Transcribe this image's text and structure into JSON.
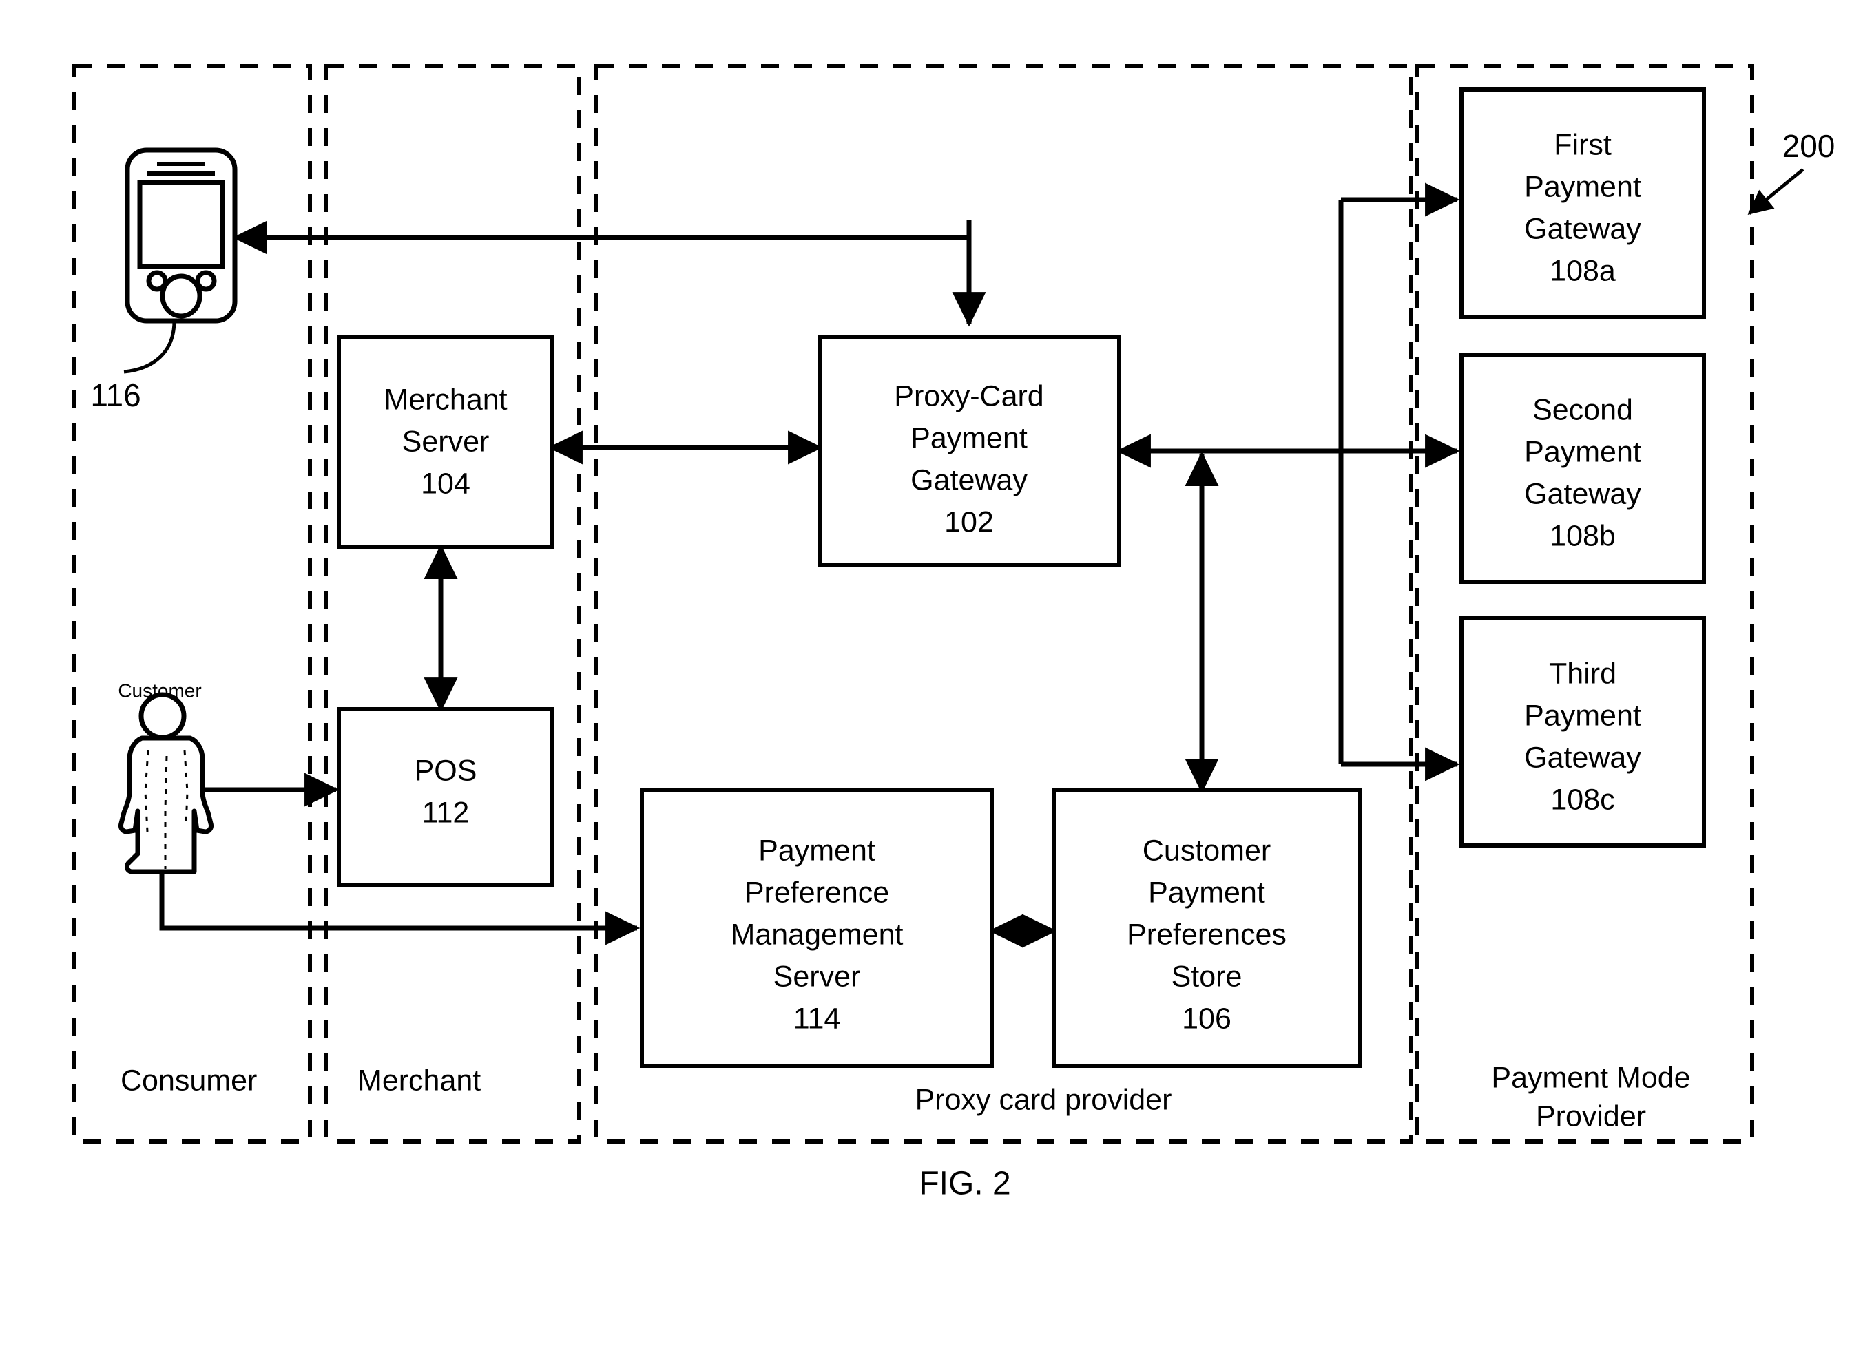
{
  "figure": {
    "caption": "FIG. 2",
    "system_reference": "200"
  },
  "zones": [
    {
      "id": "consumer",
      "label": "Consumer"
    },
    {
      "id": "merchant",
      "label": "Merchant"
    },
    {
      "id": "proxy_card_provider",
      "label": "Proxy card provider"
    },
    {
      "id": "payment_mode_provider",
      "label": "Payment Mode\nProvider",
      "label_line1": "Payment Mode",
      "label_line2": "Provider"
    }
  ],
  "nodes": {
    "mobile_device": {
      "reference": "116",
      "icon": "mobile-phone-icon"
    },
    "customer": {
      "label": "Customer",
      "icon": "person-icon"
    },
    "merchant_server": {
      "lines": [
        "Merchant",
        "Server",
        "104"
      ],
      "l1": "Merchant",
      "l2": "Server",
      "l3": "104"
    },
    "pos": {
      "lines": [
        "POS",
        "112"
      ],
      "l1": "POS",
      "l2": "112"
    },
    "proxy_card_payment_gateway": {
      "lines": [
        "Proxy-Card",
        "Payment",
        "Gateway",
        "102"
      ],
      "l1": "Proxy-Card",
      "l2": "Payment",
      "l3": "Gateway",
      "l4": "102"
    },
    "payment_preference_management_server": {
      "lines": [
        "Payment",
        "Preference",
        "Management",
        "Server",
        "114"
      ],
      "l1": "Payment",
      "l2": "Preference",
      "l3": "Management",
      "l4": "Server",
      "l5": "114"
    },
    "customer_payment_preferences_store": {
      "lines": [
        "Customer",
        "Payment",
        "Preferences",
        "Store",
        "106"
      ],
      "l1": "Customer",
      "l2": "Payment",
      "l3": "Preferences",
      "l4": "Store",
      "l5": "106"
    },
    "first_payment_gateway": {
      "lines": [
        "First",
        "Payment",
        "Gateway",
        "108a"
      ],
      "l1": "First",
      "l2": "Payment",
      "l3": "Gateway",
      "l4": "108a"
    },
    "second_payment_gateway": {
      "lines": [
        "Second",
        "Payment",
        "Gateway",
        "108b"
      ],
      "l1": "Second",
      "l2": "Payment",
      "l3": "Gateway",
      "l4": "108b"
    },
    "third_payment_gateway": {
      "lines": [
        "Third",
        "Payment",
        "Gateway",
        "108c"
      ],
      "l1": "Third",
      "l2": "Payment",
      "l3": "Gateway",
      "l4": "108c"
    }
  },
  "connections": [
    {
      "from": "proxy_card_payment_gateway",
      "to": "mobile_device",
      "direction": "one-way"
    },
    {
      "from": "merchant_server",
      "to": "proxy_card_payment_gateway",
      "direction": "two-way"
    },
    {
      "from": "pos",
      "to": "merchant_server",
      "direction": "two-way"
    },
    {
      "from": "customer",
      "to": "pos",
      "direction": "one-way"
    },
    {
      "from": "customer",
      "to": "payment_preference_management_server",
      "direction": "one-way"
    },
    {
      "from": "payment_preference_management_server",
      "to": "customer_payment_preferences_store",
      "direction": "two-way"
    },
    {
      "from": "customer_payment_preferences_store",
      "to": "proxy_card_payment_gateway",
      "direction": "two-way"
    },
    {
      "from": "proxy_card_payment_gateway",
      "to": "second_payment_gateway",
      "direction": "two-way"
    },
    {
      "from": "proxy_card_payment_gateway",
      "to": "first_payment_gateway",
      "direction": "one-way"
    },
    {
      "from": "proxy_card_payment_gateway",
      "to": "third_payment_gateway",
      "direction": "one-way"
    }
  ],
  "colors": {
    "stroke": "#000000",
    "background": "#ffffff"
  }
}
